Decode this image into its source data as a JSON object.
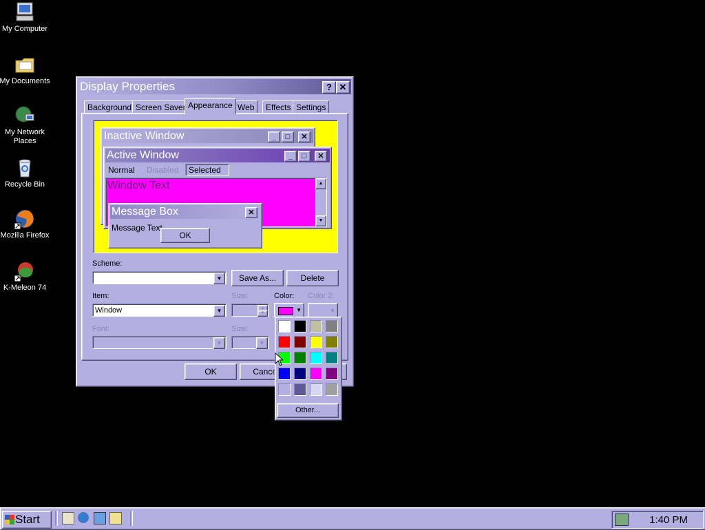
{
  "desktop": {
    "icons": [
      {
        "label": "My Computer",
        "icon": "computer-icon"
      },
      {
        "label": "My Documents",
        "icon": "folder-icon"
      },
      {
        "label": "My Network Places",
        "icon": "network-icon"
      },
      {
        "label": "Recycle Bin",
        "icon": "recycle-bin-icon"
      },
      {
        "label": "Mozilla Firefox",
        "icon": "firefox-icon"
      },
      {
        "label": "K-Meleon 74",
        "icon": "kmeleon-icon"
      }
    ]
  },
  "dialog": {
    "title": "Display Properties",
    "help_label": "?",
    "close_label": "✕",
    "tabs": [
      "Background",
      "Screen Saver",
      "Appearance",
      "Web",
      "Effects",
      "Settings"
    ],
    "selected_tab": "Appearance",
    "preview": {
      "inactive_title": "Inactive Window",
      "active_title": "Active Window",
      "menu": [
        "Normal",
        "Disabled",
        "Selected"
      ],
      "window_text": "Window Text",
      "message_title": "Message Box",
      "message_text": "Message Text",
      "ok_label": "OK"
    },
    "scheme_label": "Scheme:",
    "scheme_value": "",
    "save_as_label": "Save As...",
    "delete_label": "Delete",
    "item_label": "Item:",
    "item_value": "Window",
    "size_label": "Size:",
    "color_label": "Color:",
    "color2_label": "Color 2:",
    "font_label": "Font:",
    "font_size_label": "Size:",
    "ok_label": "OK",
    "cancel_label": "Cancel"
  },
  "color_popup": {
    "swatches": [
      "#ffffff",
      "#000000",
      "#c0c0a0",
      "#808080",
      "#ff0000",
      "#800000",
      "#ffff00",
      "#808000",
      "#00ff00",
      "#008000",
      "#00ffff",
      "#008080",
      "#0000ff",
      "#000080",
      "#ff00ff",
      "#800080",
      "#b4afe1",
      "#5e5a98",
      "#d8d6f0",
      "#a0a0a0"
    ],
    "current_color": "#ff00ff",
    "other_label": "Other..."
  },
  "taskbar": {
    "start_label": "Start",
    "quick_launch": [
      "desktop-icon",
      "ie-icon",
      "outlook-icon",
      "search-icon"
    ],
    "clock": "1:40 PM"
  },
  "colors": {
    "face": "#b4afe1",
    "preview_bg": "#ffff00",
    "window_bg": "#ff00ff"
  }
}
